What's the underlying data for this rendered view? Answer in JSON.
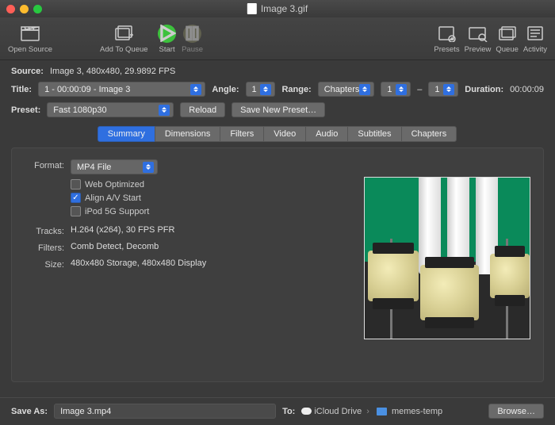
{
  "window": {
    "title": "Image 3.gif"
  },
  "toolbar": {
    "open_source": "Open Source",
    "add_to_queue": "Add To Queue",
    "start": "Start",
    "pause": "Pause",
    "presets": "Presets",
    "preview": "Preview",
    "queue": "Queue",
    "activity": "Activity"
  },
  "source": {
    "label": "Source:",
    "value": "Image 3, 480x480, 29.9892 FPS"
  },
  "title": {
    "label": "Title:",
    "value": "1 - 00:00:09 - Image 3"
  },
  "angle": {
    "label": "Angle:",
    "value": "1"
  },
  "range": {
    "label": "Range:",
    "type": "Chapters",
    "from": "1",
    "dash": "–",
    "to": "1"
  },
  "duration": {
    "label": "Duration:",
    "value": "00:00:09"
  },
  "preset": {
    "label": "Preset:",
    "value": "Fast 1080p30",
    "reload": "Reload",
    "save_new": "Save New Preset…"
  },
  "tabs": {
    "summary": "Summary",
    "dimensions": "Dimensions",
    "filters": "Filters",
    "video": "Video",
    "audio": "Audio",
    "subtitles": "Subtitles",
    "chapters": "Chapters"
  },
  "summary": {
    "format_label": "Format:",
    "format_value": "MP4 File",
    "web_optimized": "Web Optimized",
    "align_av": "Align A/V Start",
    "ipod": "iPod 5G Support",
    "tracks_label": "Tracks:",
    "tracks_value": "H.264 (x264), 30 FPS PFR",
    "filters_label": "Filters:",
    "filters_value": "Comb Detect, Decomb",
    "size_label": "Size:",
    "size_value": "480x480 Storage, 480x480 Display"
  },
  "saveas": {
    "label": "Save As:",
    "value": "Image 3.mp4",
    "to_label": "To:",
    "dest1": "iCloud Drive",
    "dest2": "memes-temp",
    "browse": "Browse…"
  }
}
